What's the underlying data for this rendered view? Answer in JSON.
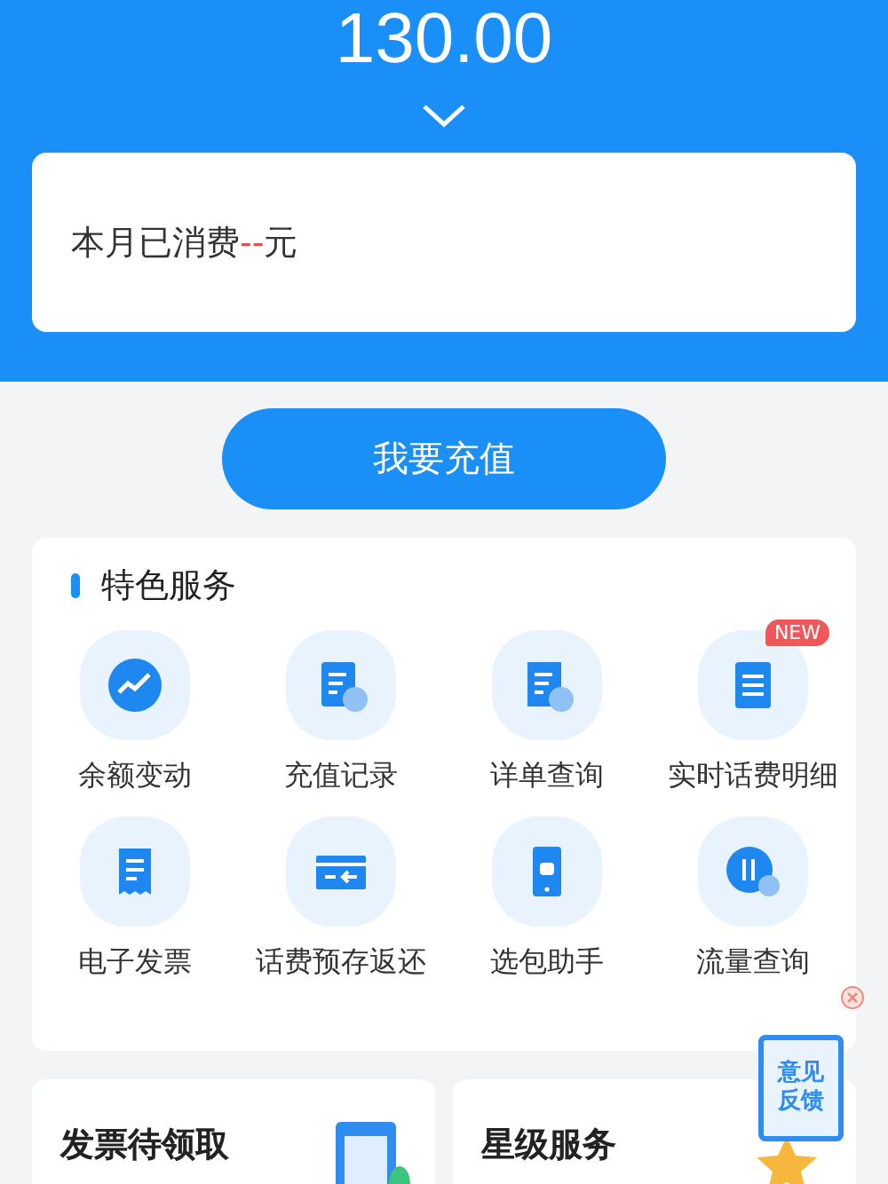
{
  "balance": {
    "amount": "130.00"
  },
  "month_card": {
    "text": "本月已消费**--**元"
  },
  "recharge_button": "我要充值",
  "services": {
    "title": "特色服务",
    "items": [
      {
        "label": "余额变动",
        "kind": "trend"
      },
      {
        "label": "充值记录",
        "kind": "recharge"
      },
      {
        "label": "详单查询",
        "kind": "detail"
      },
      {
        "label": "实时话费明细",
        "kind": "list",
        "badge": "NEW"
      },
      {
        "label": "电子发票",
        "kind": "receipt"
      },
      {
        "label": "话费预存返还",
        "kind": "card"
      },
      {
        "label": "选包助手",
        "kind": "phone"
      },
      {
        "label": "流量查询",
        "kind": "data"
      }
    ]
  },
  "promos": [
    {
      "title": "发票待领取",
      "kind": "invoice"
    },
    {
      "title": "星级服务",
      "kind": "star"
    }
  ],
  "feedback": {
    "label": "意见反馈"
  }
}
